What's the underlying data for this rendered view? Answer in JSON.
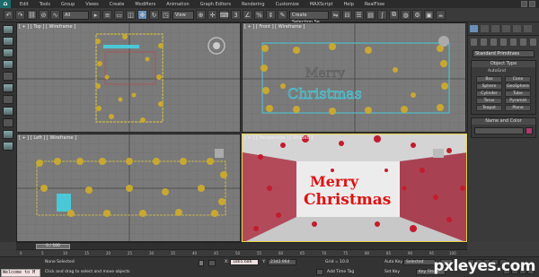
{
  "app": {
    "logo_glyph": "⌂"
  },
  "menu": [
    "Edit",
    "Tools",
    "Group",
    "Views",
    "Create",
    "Modifiers",
    "Animation",
    "Graph Editors",
    "Rendering",
    "Customize",
    "MAXScript",
    "Help",
    "RealFlow"
  ],
  "toolbar": {
    "filter_value": "All",
    "coord_value": "View",
    "selection_set_placeholder": "Create Selection Se"
  },
  "viewports": {
    "top_label": "[ + ] [ Top ] [ Wireframe ]",
    "front_label": "[ + ] [ Front ] [ Wireframe ]",
    "left_label": "[ + ] [ Left ] [ Wireframe ]",
    "perspective_label": "[ + ] [ Perspective ] [ Shaded ]",
    "title_line1": "Merry",
    "title_line2": "Christmas"
  },
  "command_panel": {
    "category_value": "Standard Primitives",
    "object_type_title": "Object Type",
    "autogrid_label": "AutoGrid",
    "buttons": [
      "Box",
      "Cone",
      "Sphere",
      "GeoSphere",
      "Cylinder",
      "Tube",
      "Torus",
      "Pyramid",
      "Teapot",
      "Plane"
    ],
    "name_color_title": "Name and Color",
    "swatch_color": "#b0386d"
  },
  "timeline": {
    "slider_text": "0 / 100",
    "ticks": [
      "0",
      "5",
      "10",
      "15",
      "20",
      "25",
      "30",
      "35",
      "40",
      "45",
      "50",
      "55",
      "60",
      "65",
      "70",
      "75",
      "80",
      "85",
      "90",
      "95",
      "100"
    ]
  },
  "status": {
    "welcome": "Welcome to M",
    "selection": "None Selected",
    "prompt": "Click and drag to select and move objects",
    "x_label": "X:",
    "y_label": "Y:",
    "x_value": "1865.686",
    "y_value": "2342.964",
    "grid_text": "Grid = 10.0",
    "add_time_tag": "Add Time Tag",
    "auto_key": "Auto Key",
    "selected": "Selected",
    "set_key": "Set Key",
    "key_filters": "Key Filters..."
  },
  "watermark": "pxleyes.com"
}
